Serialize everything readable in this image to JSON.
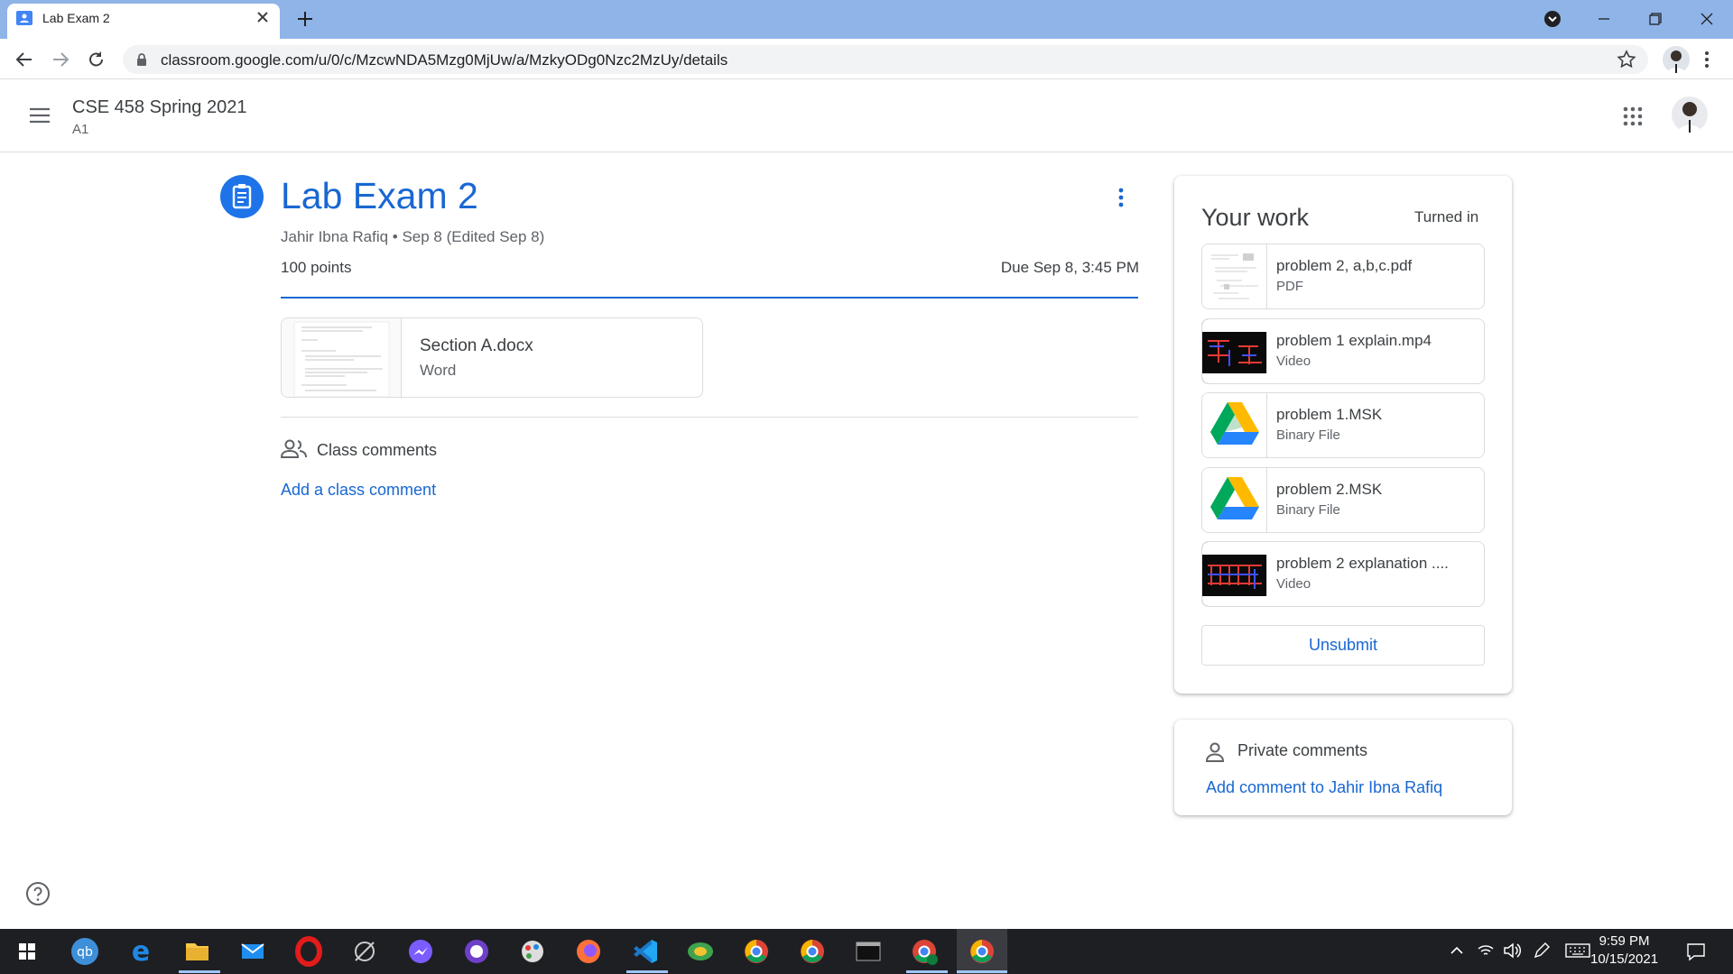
{
  "browser": {
    "tab_title": "Lab Exam 2",
    "url": "classroom.google.com/u/0/c/MzcwNDA5Mzg0MjUw/a/MzkyODg0Nzc2MzUy/details"
  },
  "header": {
    "course_name": "CSE 458 Spring 2021",
    "section": "A1"
  },
  "assignment": {
    "title": "Lab Exam 2",
    "meta": "Jahir Ibna Rafiq • Sep 8 (Edited Sep 8)",
    "points": "100 points",
    "due": "Due Sep 8, 3:45 PM",
    "attachment": {
      "name": "Section A.docx",
      "type": "Word"
    }
  },
  "class_comments": {
    "label": "Class comments",
    "add_link": "Add a class comment"
  },
  "your_work": {
    "title": "Your work",
    "status": "Turned in",
    "files": [
      {
        "name": "problem 2, a,b,c.pdf",
        "type": "PDF",
        "thumb": "pdf-thumb"
      },
      {
        "name": "problem 1 explain.mp4",
        "type": "Video",
        "thumb": "video-thumb"
      },
      {
        "name": "problem 1.MSK",
        "type": "Binary File",
        "thumb": "drive-icon"
      },
      {
        "name": "problem 2.MSK",
        "type": "Binary File",
        "thumb": "drive-icon"
      },
      {
        "name": "problem 2 explanation ....",
        "type": "Video",
        "thumb": "video-thumb"
      }
    ],
    "unsubmit_label": "Unsubmit"
  },
  "private_comments": {
    "label": "Private comments",
    "add_link": "Add comment to Jahir Ibna Rafiq"
  },
  "taskbar": {
    "time": "9:59 PM",
    "date": "10/15/2021"
  },
  "colors": {
    "accent": "#1967d2",
    "tabstrip": "#8fb4e8",
    "taskbar": "#1e1f23"
  }
}
